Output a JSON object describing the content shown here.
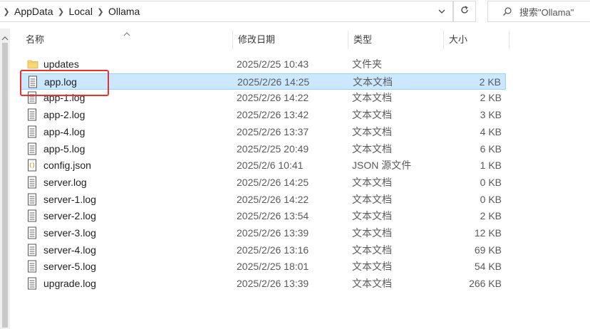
{
  "address": {
    "crumbs": [
      "AppData",
      "Local",
      "Ollama"
    ]
  },
  "search": {
    "placeholder": "搜索\"Ollama\""
  },
  "columns": {
    "name": "名称",
    "date": "修改日期",
    "type": "类型",
    "size": "大小"
  },
  "files": [
    {
      "name": "updates",
      "date": "2025/2/25 10:43",
      "type": "文件夹",
      "size": "",
      "icon": "folder-icon"
    },
    {
      "name": "app.log",
      "date": "2025/2/26 14:25",
      "type": "文本文档",
      "size": "2 KB",
      "icon": "text-file-icon"
    },
    {
      "name": "app-1.log",
      "date": "2025/2/26 14:22",
      "type": "文本文档",
      "size": "2 KB",
      "icon": "text-file-icon"
    },
    {
      "name": "app-2.log",
      "date": "2025/2/26 13:42",
      "type": "文本文档",
      "size": "3 KB",
      "icon": "text-file-icon"
    },
    {
      "name": "app-4.log",
      "date": "2025/2/26 13:37",
      "type": "文本文档",
      "size": "4 KB",
      "icon": "text-file-icon"
    },
    {
      "name": "app-5.log",
      "date": "2025/2/25 20:49",
      "type": "文本文档",
      "size": "6 KB",
      "icon": "text-file-icon"
    },
    {
      "name": "config.json",
      "date": "2025/2/6 10:41",
      "type": "JSON 源文件",
      "size": "1 KB",
      "icon": "json-file-icon"
    },
    {
      "name": "server.log",
      "date": "2025/2/26 14:25",
      "type": "文本文档",
      "size": "0 KB",
      "icon": "text-file-icon"
    },
    {
      "name": "server-1.log",
      "date": "2025/2/26 14:22",
      "type": "文本文档",
      "size": "0 KB",
      "icon": "text-file-icon"
    },
    {
      "name": "server-2.log",
      "date": "2025/2/26 13:54",
      "type": "文本文档",
      "size": "2 KB",
      "icon": "text-file-icon"
    },
    {
      "name": "server-3.log",
      "date": "2025/2/26 13:39",
      "type": "文本文档",
      "size": "12 KB",
      "icon": "text-file-icon"
    },
    {
      "name": "server-4.log",
      "date": "2025/2/26 13:16",
      "type": "文本文档",
      "size": "69 KB",
      "icon": "text-file-icon"
    },
    {
      "name": "server-5.log",
      "date": "2025/2/25 18:01",
      "type": "文本文档",
      "size": "54 KB",
      "icon": "text-file-icon"
    },
    {
      "name": "upgrade.log",
      "date": "2025/2/26 13:39",
      "type": "文本文档",
      "size": "266 KB",
      "icon": "text-file-icon"
    }
  ],
  "selected_file": "app.log",
  "colors": {
    "selection_bg": "#cce8ff",
    "selection_border": "#99d1ff",
    "annotation_red": "#e8322f",
    "folder_yellow": "#f8d775"
  }
}
